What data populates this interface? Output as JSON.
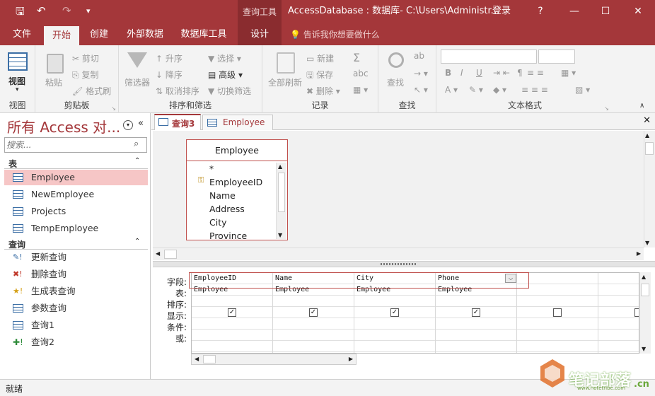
{
  "titlebar": {
    "save_icon": "save-icon",
    "undo_icon": "undo-icon",
    "redo_icon": "redo-icon",
    "customize_icon": "chevron-down-icon",
    "context_tools": "查询工具",
    "title": "AccessDatabase : 数据库- C:\\Users\\Administr...",
    "login": "登录",
    "help": "?",
    "minimize": "—",
    "maximize": "☐",
    "close": "✕",
    "accent": "#a4373a"
  },
  "ribbon_tabs": [
    "文件",
    "开始",
    "创建",
    "外部数据",
    "数据库工具",
    "设计"
  ],
  "tell_me": "告诉我你想要做什么",
  "ribbon": {
    "view": {
      "label": "视图",
      "group": "视图"
    },
    "clipboard": {
      "paste": "粘贴",
      "cut": "剪切",
      "copy": "复制",
      "format_painter": "格式刷",
      "group": "剪贴板"
    },
    "sort_filter": {
      "filter": "筛选器",
      "ascending": "升序",
      "descending": "降序",
      "remove_sort": "取消排序",
      "selection": "选择",
      "advanced": "高级",
      "toggle_filter": "切换筛选",
      "group": "排序和筛选"
    },
    "records": {
      "refresh_all": "全部刷新",
      "new": "新建",
      "save": "保存",
      "delete": "删除",
      "group": "记录"
    },
    "find": {
      "find": "查找",
      "group": "查找"
    },
    "text_format": {
      "group": "文本格式"
    }
  },
  "nav": {
    "title": "所有 Access 对...",
    "search_placeholder": "搜索...",
    "tables_header": "表",
    "tables": [
      "Employee",
      "NewEmployee",
      "Projects",
      "TempEmployee"
    ],
    "queries_header": "查询",
    "queries": [
      "更新查询",
      "删除查询",
      "生成表查询",
      "参数查询",
      "查询1",
      "查询2"
    ]
  },
  "doc_tabs": [
    "查询3",
    "Employee"
  ],
  "table_box": {
    "title": "Employee",
    "fields": [
      "*",
      "EmployeeID",
      "Name",
      "Address",
      "City",
      "Province"
    ]
  },
  "qbe": {
    "row_labels": [
      "字段:",
      "表:",
      "排序:",
      "显示:",
      "条件:",
      "或:"
    ],
    "columns": [
      {
        "field": "EmployeeID",
        "table": "Employee",
        "show": true
      },
      {
        "field": "Name",
        "table": "Employee",
        "show": true
      },
      {
        "field": "City",
        "table": "Employee",
        "show": true
      },
      {
        "field": "Phone",
        "table": "Employee",
        "show": true
      },
      {
        "field": "",
        "table": "",
        "show": false
      }
    ]
  },
  "status": {
    "text": "就绪"
  },
  "watermark": {
    "text": "笔记部落",
    "sub": "www.notetribe.com",
    "tld": ".cn"
  }
}
